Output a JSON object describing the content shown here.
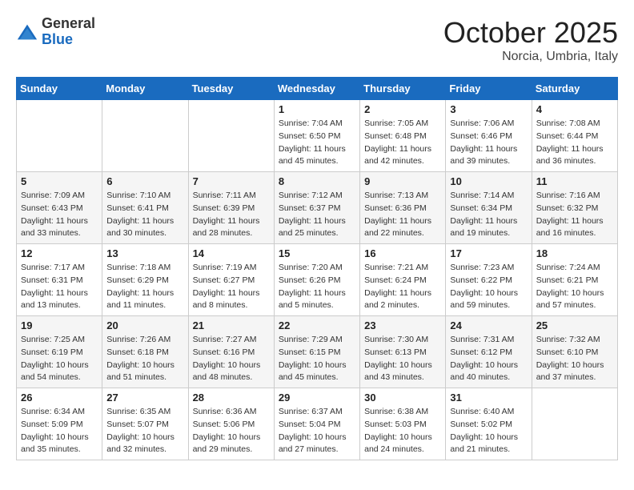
{
  "header": {
    "logo": {
      "general": "General",
      "blue": "Blue"
    },
    "title": "October 2025",
    "subtitle": "Norcia, Umbria, Italy"
  },
  "calendar": {
    "days_of_week": [
      "Sunday",
      "Monday",
      "Tuesday",
      "Wednesday",
      "Thursday",
      "Friday",
      "Saturday"
    ],
    "weeks": [
      [
        {
          "day": "",
          "info": ""
        },
        {
          "day": "",
          "info": ""
        },
        {
          "day": "",
          "info": ""
        },
        {
          "day": "1",
          "info": "Sunrise: 7:04 AM\nSunset: 6:50 PM\nDaylight: 11 hours\nand 45 minutes."
        },
        {
          "day": "2",
          "info": "Sunrise: 7:05 AM\nSunset: 6:48 PM\nDaylight: 11 hours\nand 42 minutes."
        },
        {
          "day": "3",
          "info": "Sunrise: 7:06 AM\nSunset: 6:46 PM\nDaylight: 11 hours\nand 39 minutes."
        },
        {
          "day": "4",
          "info": "Sunrise: 7:08 AM\nSunset: 6:44 PM\nDaylight: 11 hours\nand 36 minutes."
        }
      ],
      [
        {
          "day": "5",
          "info": "Sunrise: 7:09 AM\nSunset: 6:43 PM\nDaylight: 11 hours\nand 33 minutes."
        },
        {
          "day": "6",
          "info": "Sunrise: 7:10 AM\nSunset: 6:41 PM\nDaylight: 11 hours\nand 30 minutes."
        },
        {
          "day": "7",
          "info": "Sunrise: 7:11 AM\nSunset: 6:39 PM\nDaylight: 11 hours\nand 28 minutes."
        },
        {
          "day": "8",
          "info": "Sunrise: 7:12 AM\nSunset: 6:37 PM\nDaylight: 11 hours\nand 25 minutes."
        },
        {
          "day": "9",
          "info": "Sunrise: 7:13 AM\nSunset: 6:36 PM\nDaylight: 11 hours\nand 22 minutes."
        },
        {
          "day": "10",
          "info": "Sunrise: 7:14 AM\nSunset: 6:34 PM\nDaylight: 11 hours\nand 19 minutes."
        },
        {
          "day": "11",
          "info": "Sunrise: 7:16 AM\nSunset: 6:32 PM\nDaylight: 11 hours\nand 16 minutes."
        }
      ],
      [
        {
          "day": "12",
          "info": "Sunrise: 7:17 AM\nSunset: 6:31 PM\nDaylight: 11 hours\nand 13 minutes."
        },
        {
          "day": "13",
          "info": "Sunrise: 7:18 AM\nSunset: 6:29 PM\nDaylight: 11 hours\nand 11 minutes."
        },
        {
          "day": "14",
          "info": "Sunrise: 7:19 AM\nSunset: 6:27 PM\nDaylight: 11 hours\nand 8 minutes."
        },
        {
          "day": "15",
          "info": "Sunrise: 7:20 AM\nSunset: 6:26 PM\nDaylight: 11 hours\nand 5 minutes."
        },
        {
          "day": "16",
          "info": "Sunrise: 7:21 AM\nSunset: 6:24 PM\nDaylight: 11 hours\nand 2 minutes."
        },
        {
          "day": "17",
          "info": "Sunrise: 7:23 AM\nSunset: 6:22 PM\nDaylight: 10 hours\nand 59 minutes."
        },
        {
          "day": "18",
          "info": "Sunrise: 7:24 AM\nSunset: 6:21 PM\nDaylight: 10 hours\nand 57 minutes."
        }
      ],
      [
        {
          "day": "19",
          "info": "Sunrise: 7:25 AM\nSunset: 6:19 PM\nDaylight: 10 hours\nand 54 minutes."
        },
        {
          "day": "20",
          "info": "Sunrise: 7:26 AM\nSunset: 6:18 PM\nDaylight: 10 hours\nand 51 minutes."
        },
        {
          "day": "21",
          "info": "Sunrise: 7:27 AM\nSunset: 6:16 PM\nDaylight: 10 hours\nand 48 minutes."
        },
        {
          "day": "22",
          "info": "Sunrise: 7:29 AM\nSunset: 6:15 PM\nDaylight: 10 hours\nand 45 minutes."
        },
        {
          "day": "23",
          "info": "Sunrise: 7:30 AM\nSunset: 6:13 PM\nDaylight: 10 hours\nand 43 minutes."
        },
        {
          "day": "24",
          "info": "Sunrise: 7:31 AM\nSunset: 6:12 PM\nDaylight: 10 hours\nand 40 minutes."
        },
        {
          "day": "25",
          "info": "Sunrise: 7:32 AM\nSunset: 6:10 PM\nDaylight: 10 hours\nand 37 minutes."
        }
      ],
      [
        {
          "day": "26",
          "info": "Sunrise: 6:34 AM\nSunset: 5:09 PM\nDaylight: 10 hours\nand 35 minutes."
        },
        {
          "day": "27",
          "info": "Sunrise: 6:35 AM\nSunset: 5:07 PM\nDaylight: 10 hours\nand 32 minutes."
        },
        {
          "day": "28",
          "info": "Sunrise: 6:36 AM\nSunset: 5:06 PM\nDaylight: 10 hours\nand 29 minutes."
        },
        {
          "day": "29",
          "info": "Sunrise: 6:37 AM\nSunset: 5:04 PM\nDaylight: 10 hours\nand 27 minutes."
        },
        {
          "day": "30",
          "info": "Sunrise: 6:38 AM\nSunset: 5:03 PM\nDaylight: 10 hours\nand 24 minutes."
        },
        {
          "day": "31",
          "info": "Sunrise: 6:40 AM\nSunset: 5:02 PM\nDaylight: 10 hours\nand 21 minutes."
        },
        {
          "day": "",
          "info": ""
        }
      ]
    ]
  }
}
